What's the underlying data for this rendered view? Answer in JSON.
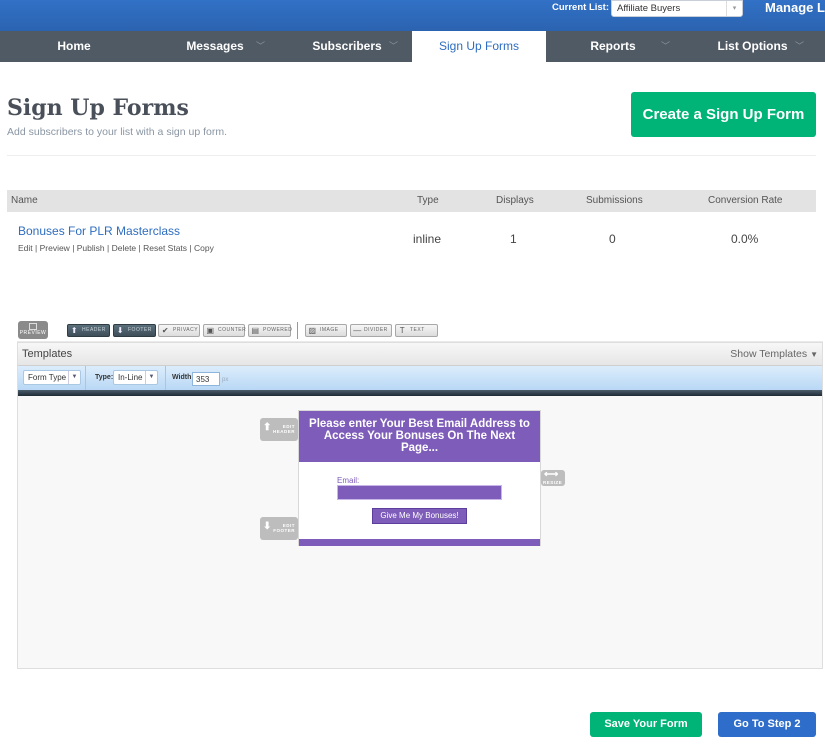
{
  "topbar": {
    "current_list_label": "Current List:",
    "current_list_value": "Affiliate Buyers",
    "manage_label": "Manage Lis"
  },
  "nav": {
    "items": [
      {
        "label": "Home",
        "has_dropdown": false,
        "active": false
      },
      {
        "label": "Messages",
        "has_dropdown": true,
        "active": false
      },
      {
        "label": "Subscribers",
        "has_dropdown": true,
        "active": false
      },
      {
        "label": "Sign Up Forms",
        "has_dropdown": false,
        "active": true
      },
      {
        "label": "Reports",
        "has_dropdown": true,
        "active": false
      },
      {
        "label": "List Options",
        "has_dropdown": true,
        "active": false
      }
    ]
  },
  "header": {
    "title": "Sign Up Forms",
    "subtitle": "Add subscribers to your list with a sign up form.",
    "create_button": "Create a Sign Up Form"
  },
  "table": {
    "columns": [
      "Name",
      "Type",
      "Displays",
      "Submissions",
      "Conversion Rate"
    ],
    "rows": [
      {
        "name": "Bonuses For PLR Masterclass",
        "actions": [
          "Edit",
          "Preview",
          "Publish",
          "Delete",
          "Reset Stats",
          "Copy"
        ],
        "type": "inline",
        "displays": "1",
        "submissions": "0",
        "conversion_rate": "0.0%"
      }
    ]
  },
  "editor": {
    "toolbar": {
      "preview": "PREVIEW",
      "buttons": [
        "HEADER",
        "FOOTER",
        "PRIVACY",
        "COUNTER",
        "POWERED",
        "IMAGE",
        "DIVIDER",
        "TEXT"
      ]
    },
    "templates_title": "Templates",
    "show_templates": "Show Templates",
    "options": {
      "form_type": "Form Type",
      "type_label": "Type:",
      "type_value": "In-Line",
      "width_label": "Width:",
      "width_value": "353",
      "width_unit": "px"
    },
    "side_buttons": {
      "edit_header": [
        "EDIT",
        "HEADER"
      ],
      "edit_footer": [
        "EDIT",
        "FOOTER"
      ],
      "resize": "RESIZE"
    },
    "form": {
      "headline": "Please enter Your Best Email Address to Access Your Bonuses On The Next Page...",
      "email_label": "Email:",
      "email_value": "",
      "submit_label": "Give Me My Bonuses!",
      "accent_color": "#7e5cb9"
    }
  },
  "footer": {
    "save_button": "Save Your Form",
    "step_button": "Go To Step 2"
  },
  "colors": {
    "topbar": "#2e6bbd",
    "nav": "#505a64",
    "link": "#2e6dbf",
    "green": "#00b377",
    "blue_button": "#2e6dc9"
  }
}
